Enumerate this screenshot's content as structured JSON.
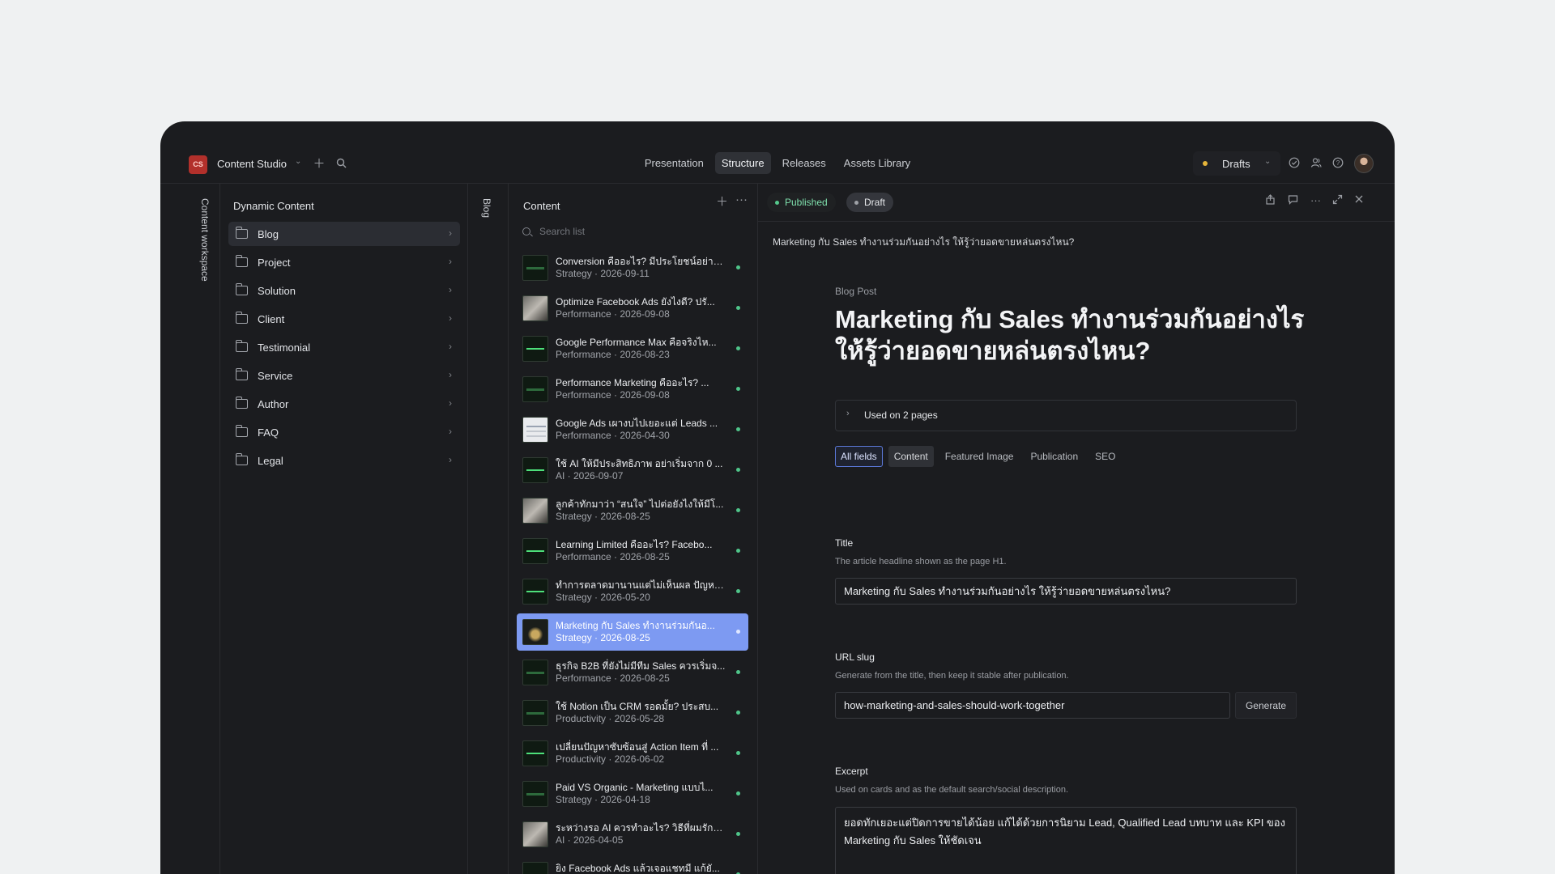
{
  "header": {
    "logo_text": "CS",
    "studio_name": "Content Studio",
    "nav": [
      "Presentation",
      "Structure",
      "Releases",
      "Assets Library"
    ],
    "active_nav": "Structure",
    "drafts_label": "Drafts"
  },
  "workspace_label": "Content workspace",
  "dynamic_content": {
    "title": "Dynamic Content",
    "folders": [
      "Blog",
      "Project",
      "Solution",
      "Client",
      "Testimonial",
      "Service",
      "Author",
      "FAQ",
      "Legal"
    ],
    "active_folder": "Blog"
  },
  "blog_rail_label": "Blog",
  "content_list": {
    "title": "Content",
    "search_placeholder": "Search list",
    "items": [
      {
        "title": "Conversion คืออะไร? มีประโยชน์อย่างไ...",
        "meta": "Strategy · 2026-09-11"
      },
      {
        "title": "Optimize Facebook Ads ยังไงดี? ปรั...",
        "meta": "Performance · 2026-09-08"
      },
      {
        "title": "Google Performance Max คือจริงไห...",
        "meta": "Performance · 2026-08-23"
      },
      {
        "title": "Performance Marketing คืออะไร? ...",
        "meta": "Performance · 2026-09-08"
      },
      {
        "title": "Google Ads เผางบไปเยอะแต่ Leads ...",
        "meta": "Performance · 2026-04-30"
      },
      {
        "title": "ใช้ AI ให้มีประสิทธิภาพ อย่าเริ่มจาก 0 ...",
        "meta": "AI · 2026-09-07"
      },
      {
        "title": "ลูกค้าทักมาว่า “สนใจ” ไปต่อยังไงให้มีโ...",
        "meta": "Strategy · 2026-08-25"
      },
      {
        "title": "Learning Limited คืออะไร? Facebo...",
        "meta": "Performance · 2026-08-25"
      },
      {
        "title": "ทำการตลาดมานานแต่ไม่เห็นผล ปัญหา...",
        "meta": "Strategy · 2026-05-20"
      },
      {
        "title": "Marketing กับ Sales ทำงานร่วมกันอ...",
        "meta": "Strategy · 2026-08-25"
      },
      {
        "title": "ธุรกิจ B2B ที่ยังไม่มีทีม Sales ควรเริ่มจ...",
        "meta": "Performance · 2026-08-25"
      },
      {
        "title": "ใช้ Notion เป็น CRM รอดมั้ย? ประสบ...",
        "meta": "Productivity · 2026-05-28"
      },
      {
        "title": "เปลี่ยนปัญหาซับซ้อนสู่ Action Item ที่ ...",
        "meta": "Productivity · 2026-06-02"
      },
      {
        "title": "Paid VS Organic - Marketing แบบไ...",
        "meta": "Strategy · 2026-04-18"
      },
      {
        "title": "ระหว่างรอ AI ควรทำอะไร? วิธีที่ผมรักษ...",
        "meta": "AI · 2026-04-05"
      },
      {
        "title": "ยิง Facebook Ads แล้วเจอแชทมี แก้ยั...",
        "meta": ""
      }
    ],
    "active_index": 9
  },
  "editor": {
    "status_published": "Published",
    "status_draft": "Draft",
    "breadcrumb_title": "Marketing กับ Sales ทำงานร่วมกันอย่างไร ให้รู้ว่ายอดขายหล่นตรงไหน?",
    "doc_type": "Blog Post",
    "doc_title": "Marketing กับ Sales ทำงานร่วมกันอย่างไร ให้รู้ว่ายอดขายหล่นตรงไหน?",
    "used_on": "Used on 2 pages",
    "tabs": [
      "All fields",
      "Content",
      "Featured Image",
      "Publication",
      "SEO"
    ],
    "fields": {
      "title": {
        "label": "Title",
        "help": "The article headline shown as the page H1.",
        "value": "Marketing กับ Sales ทำงานร่วมกันอย่างไร ให้รู้ว่ายอดขายหล่นตรงไหน?"
      },
      "slug": {
        "label": "URL slug",
        "help": "Generate from the title, then keep it stable after publication.",
        "value": "how-marketing-and-sales-should-work-together",
        "button": "Generate"
      },
      "excerpt": {
        "label": "Excerpt",
        "help": "Used on cards and as the default search/social description.",
        "value": "ยอดทักเยอะแต่ปิดการขายได้น้อย แก้ได้ด้วยการนิยาม Lead, Qualified Lead บทบาท และ KPI ของ Marketing กับ Sales ให้ชัดเจน"
      }
    }
  }
}
